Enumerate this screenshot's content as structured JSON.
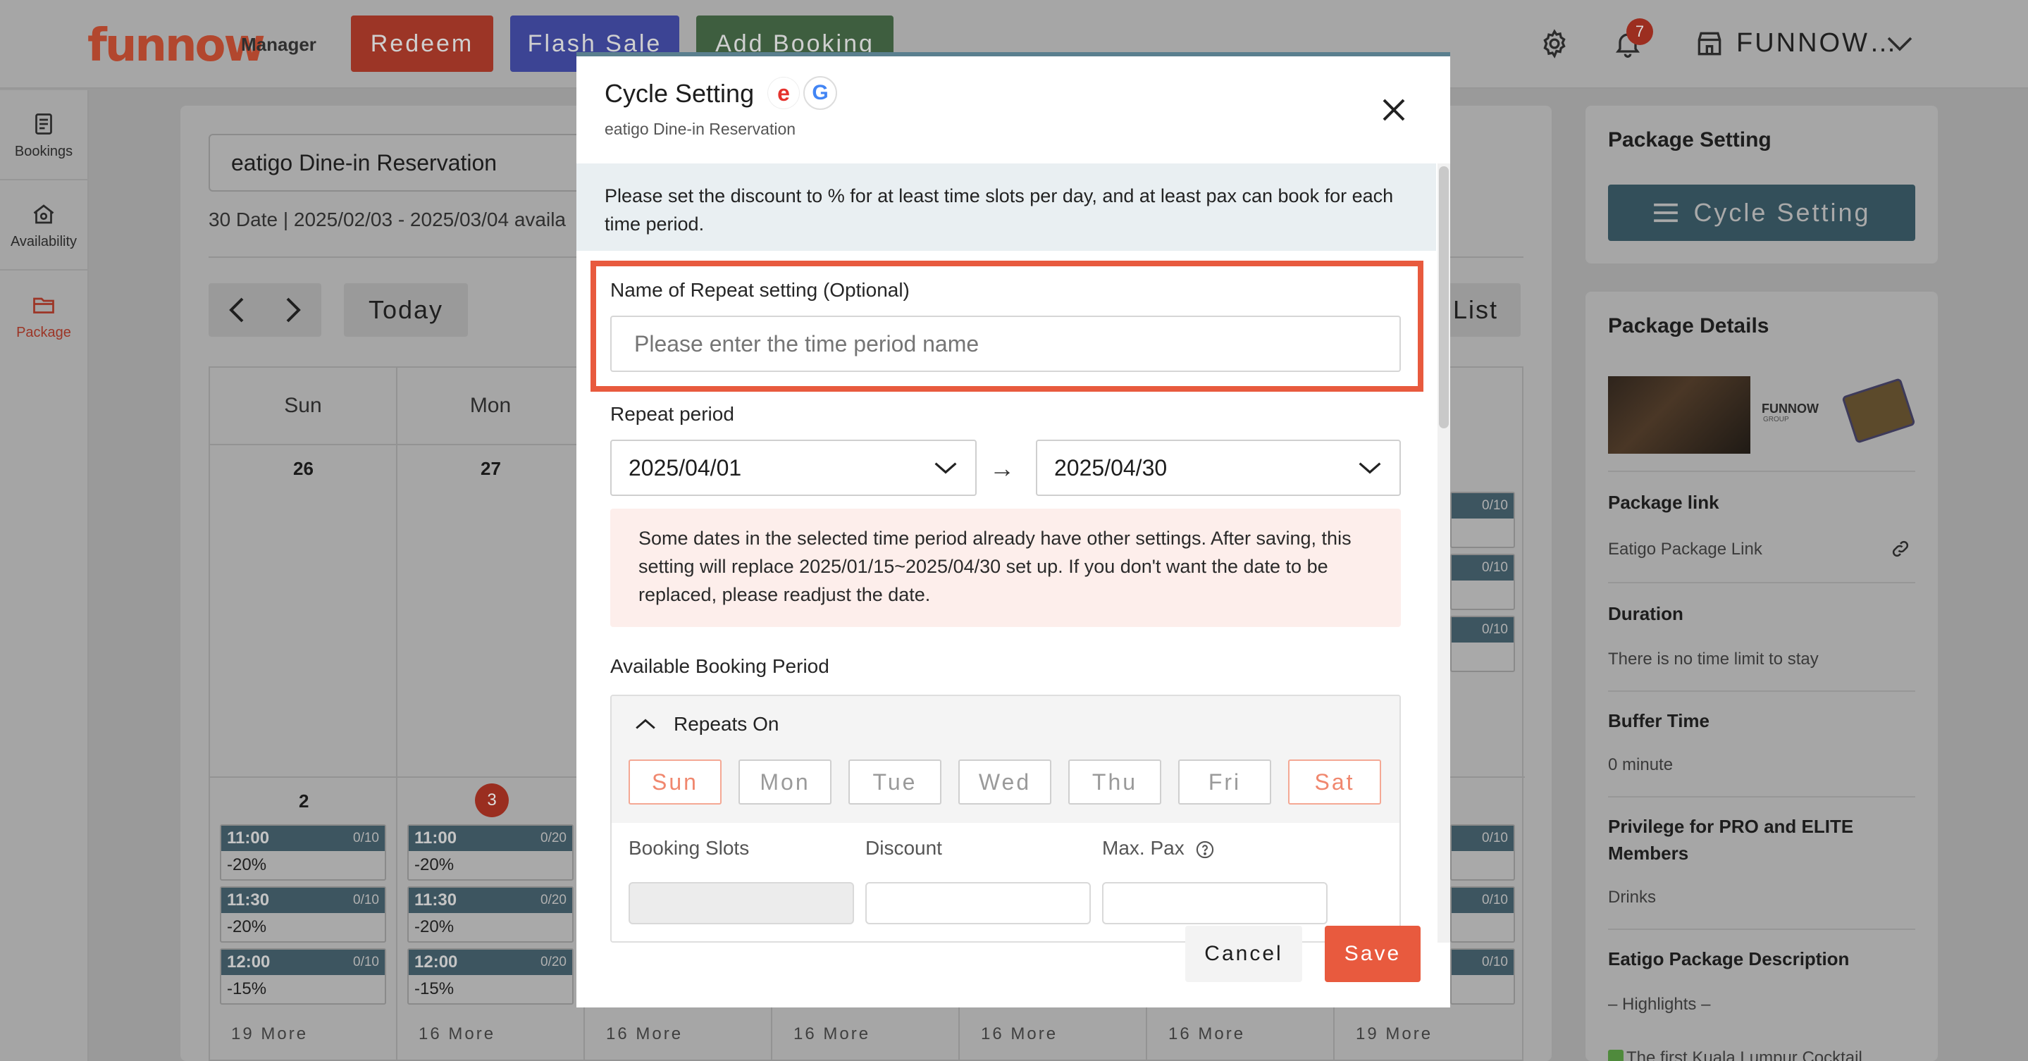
{
  "header": {
    "logo": "funnow",
    "logo_sub": "Manager",
    "buttons": [
      {
        "label": "Redeem",
        "color": "#9c3526"
      },
      {
        "label": "Flash Sale",
        "color": "#3c4494"
      },
      {
        "label": "Add Booking",
        "color": "#3e5e3f"
      }
    ],
    "notification_count": "7",
    "shop_name": "FUNNOW…"
  },
  "sidebar": {
    "items": [
      {
        "label": "Bookings",
        "icon": "document-icon"
      },
      {
        "label": "Availability",
        "icon": "store-icon"
      },
      {
        "label": "Package",
        "icon": "folder-icon",
        "active": true
      }
    ]
  },
  "main": {
    "package_select": "eatigo Dine-in Reservation",
    "date_info": "30 Date | 2025/02/03 - 2025/03/04 availa",
    "today_label": "Today",
    "list_label": "List",
    "weekdays": [
      "Sun",
      "Mon"
    ],
    "week1_days": [
      "26",
      "27"
    ],
    "week2_days": [
      "2",
      "3"
    ],
    "col_sun_slots": [
      {
        "time": "11:00",
        "count": "0/10",
        "discount": "-20%"
      },
      {
        "time": "11:30",
        "count": "0/10",
        "discount": "-20%"
      },
      {
        "time": "12:00",
        "count": "0/10",
        "discount": "-15%"
      }
    ],
    "col_mon_slots": [
      {
        "time": "11:00",
        "count": "0/20",
        "discount": "-20%"
      },
      {
        "time": "11:30",
        "count": "0/20",
        "discount": "-20%"
      },
      {
        "time": "12:00",
        "count": "0/20",
        "discount": "-15%"
      }
    ],
    "right_col_counts": [
      "0/10",
      "0/10",
      "0/10",
      "0/10",
      "0/10",
      "0/10"
    ],
    "more_labels": [
      "19 More",
      "16 More",
      "16 More",
      "16 More",
      "16 More",
      "16 More",
      "19 More"
    ]
  },
  "right_panel": {
    "package_setting_title": "Package Setting",
    "cycle_setting_button": "Cycle Setting",
    "package_details_title": "Package Details",
    "brand_text": "FUNNOW",
    "brand_sub": "GROUP",
    "package_link_label": "Package link",
    "package_link_value": "Eatigo Package Link",
    "duration_label": "Duration",
    "duration_value": "There is no time limit to stay",
    "buffer_label": "Buffer Time",
    "buffer_value": "0 minute",
    "privilege_label_1": "Privilege for PRO and ELITE",
    "privilege_label_2": "Members",
    "privilege_value": "Drinks",
    "description_label": "Eatigo Package Description",
    "description_value": "– Highlights –",
    "description_cut": "The first Kuala Lumpur Cocktail"
  },
  "modal": {
    "title": "Cycle Setting",
    "eatigo_glyph": "e",
    "google_glyph": "G",
    "subtitle": "eatigo Dine-in Reservation",
    "info_text": "Please set the discount to % for at least time slots per day, and at least pax can book for each time period.",
    "name_label": "Name of Repeat setting (Optional)",
    "name_placeholder": "Please enter the time period name",
    "repeat_period_label": "Repeat period",
    "start_date": "2025/04/01",
    "arrow": "→",
    "end_date": "2025/04/30",
    "warning_text": "Some dates in the selected time period already have other settings. After saving, this setting will replace 2025/01/15~2025/04/30 set up. If you don't want the date to be replaced, please readjust the date.",
    "available_period_label": "Available Booking Period",
    "repeats_on_label": "Repeats On",
    "days": [
      {
        "label": "Sun",
        "selected": true
      },
      {
        "label": "Mon",
        "selected": false
      },
      {
        "label": "Tue",
        "selected": false
      },
      {
        "label": "Wed",
        "selected": false
      },
      {
        "label": "Thu",
        "selected": false
      },
      {
        "label": "Fri",
        "selected": false
      },
      {
        "label": "Sat",
        "selected": true
      }
    ],
    "col_booking_slots": "Booking Slots",
    "col_discount": "Discount",
    "col_max_pax": "Max. Pax",
    "cancel_label": "Cancel",
    "save_label": "Save"
  }
}
